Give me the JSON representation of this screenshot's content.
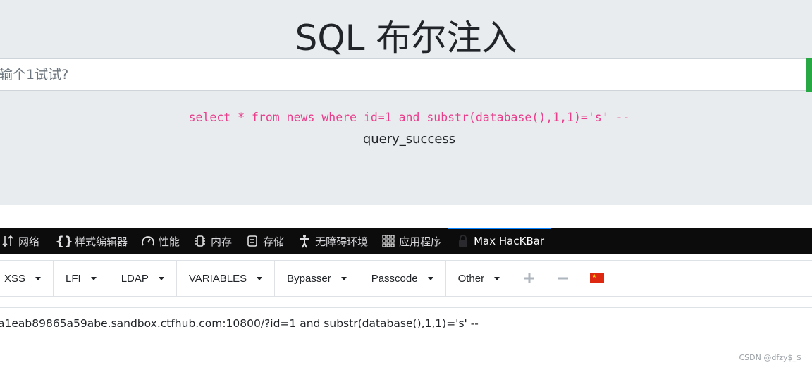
{
  "page": {
    "title": "SQL 布尔注入",
    "input_placeholder": "输个1试试?",
    "query": "select * from news where id=1 and substr(database(),1,1)='s' --",
    "result": "query_success",
    "accent_color": "#28a745",
    "query_color": "#e83e8c"
  },
  "devtools": {
    "tabs": [
      {
        "label": "网络",
        "icon": "network-arrows-icon"
      },
      {
        "label": "样式编辑器",
        "icon": "braces-icon"
      },
      {
        "label": "性能",
        "icon": "gauge-icon"
      },
      {
        "label": "内存",
        "icon": "memory-chip-icon"
      },
      {
        "label": "存储",
        "icon": "storage-icon"
      },
      {
        "label": "无障碍环境",
        "icon": "accessibility-icon"
      },
      {
        "label": "应用程序",
        "icon": "grid-apps-icon"
      },
      {
        "label": "Max HacKBar",
        "icon": "lock-icon",
        "active": true
      }
    ]
  },
  "hackbar": {
    "menus": [
      "XSS",
      "LFI",
      "LDAP",
      "VARIABLES",
      "Bypasser",
      "Passcode",
      "Other"
    ],
    "plus_icon": "plus-icon",
    "minus_icon": "minus-icon",
    "flag_icon": "china-flag-icon",
    "url": "a1eab89865a59abe.sandbox.ctfhub.com:10800/?id=1 and substr(database(),1,1)='s' --"
  },
  "watermark": "CSDN @dfzy$_$"
}
